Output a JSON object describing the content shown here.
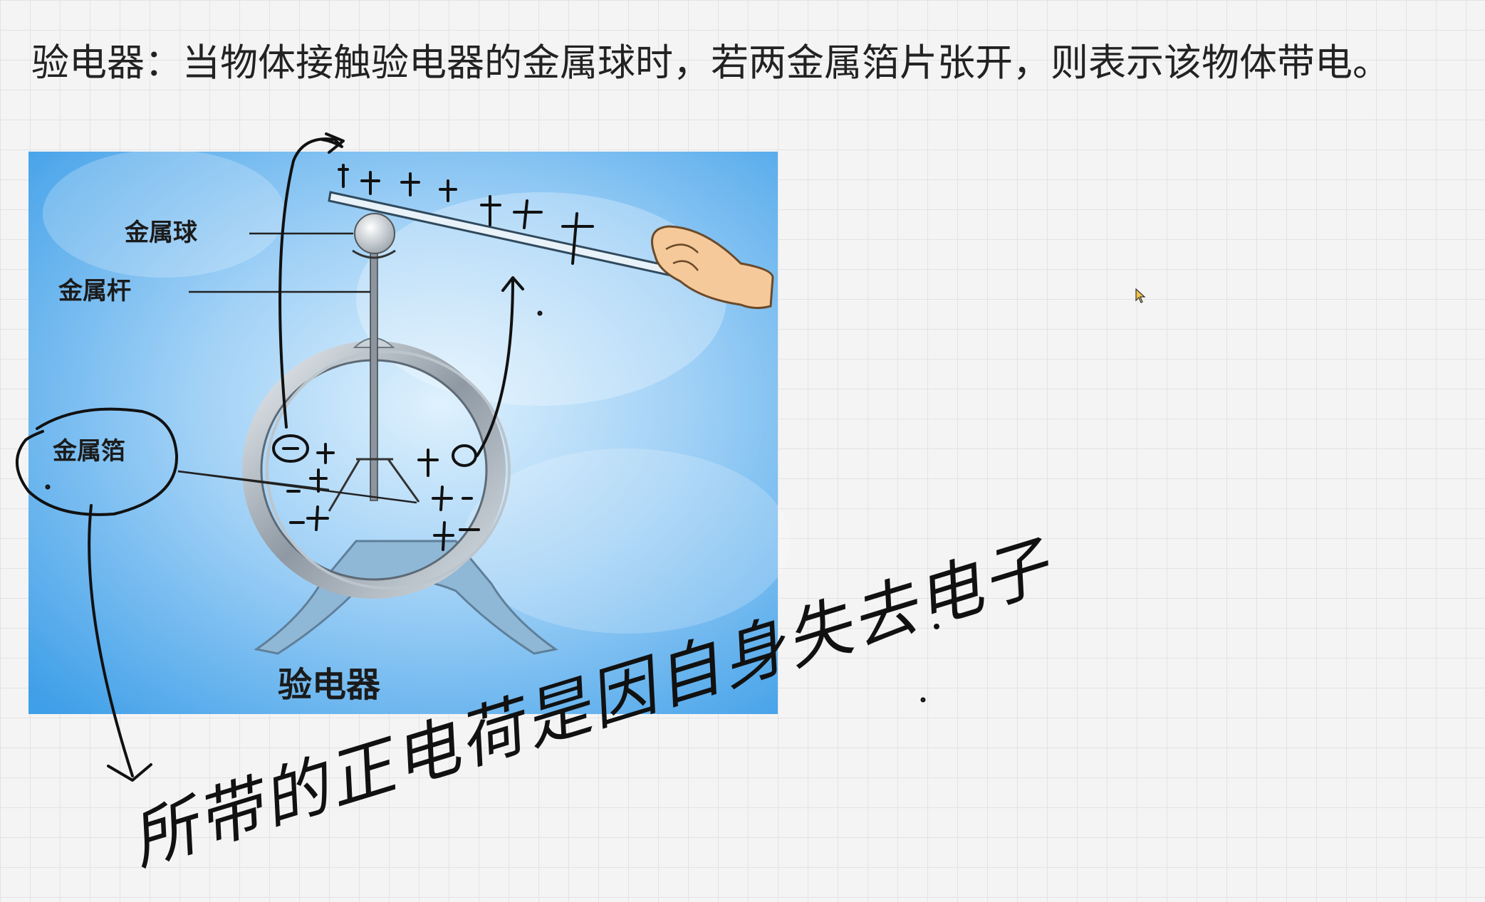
{
  "heading": "验电器：当物体接触验电器的金属球时，若两金属箔片张开，则表示该物体带电。",
  "figure": {
    "labels": {
      "ball": "金属球",
      "rod": "金属杆",
      "foil": "金属箔"
    },
    "caption": "验电器"
  },
  "annotation_text": "所带的正电荷是因自身失去电子",
  "colors": {
    "sky_light": "#cde9fb",
    "sky_dark": "#3da0ec",
    "ink": "#111111"
  },
  "icons": [
    "mouse-cursor-icon"
  ]
}
